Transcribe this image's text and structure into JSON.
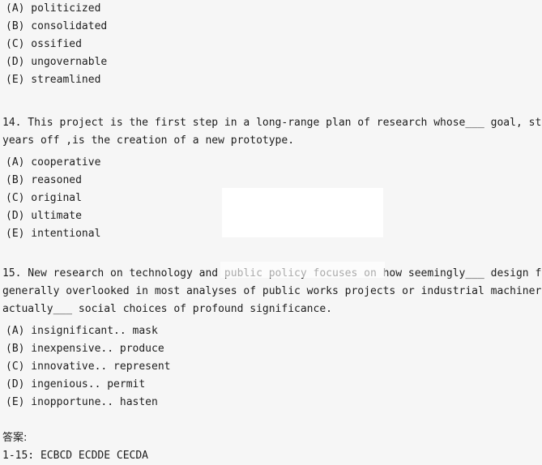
{
  "page": {
    "background_color": "#f6f6f6",
    "text_color": "#1d1d1d"
  },
  "question_13_options": [
    "(A) politicized",
    "(B) consolidated",
    "(C) ossified",
    "(D) ungovernable",
    "(E) streamlined"
  ],
  "question_14": {
    "stem_line_1": "14. This project is the first step in a long-range plan of research whose___ goal, still many",
    "stem_line_2": "years off ,is the creation of a new prototype.",
    "options": [
      "(A) cooperative",
      "(B) reasoned",
      "(C) original",
      "(D) ultimate",
      "(E) intentional"
    ]
  },
  "question_15": {
    "stem_line_1": "15. New research on technology and public policy focuses on how seemingly___ design features ,",
    "stem_line_2": "generally overlooked in most analyses of public works projects or industrial machinery,",
    "stem_line_3": "actually___ social choices of profound significance.",
    "options": [
      "(A) insignificant.. mask",
      "(B) inexpensive.. produce",
      "(C) innovative.. represent",
      "(D) ingenious.. permit",
      "(E) inopportune.. hasten"
    ]
  },
  "answer_key": {
    "heading": "答案:",
    "line": "1-15: ECBCD ECDDE CECDA"
  },
  "overlays": {
    "white_box_color": "#ffffff",
    "wash_color": "rgba(255,255,255,0.62)"
  }
}
